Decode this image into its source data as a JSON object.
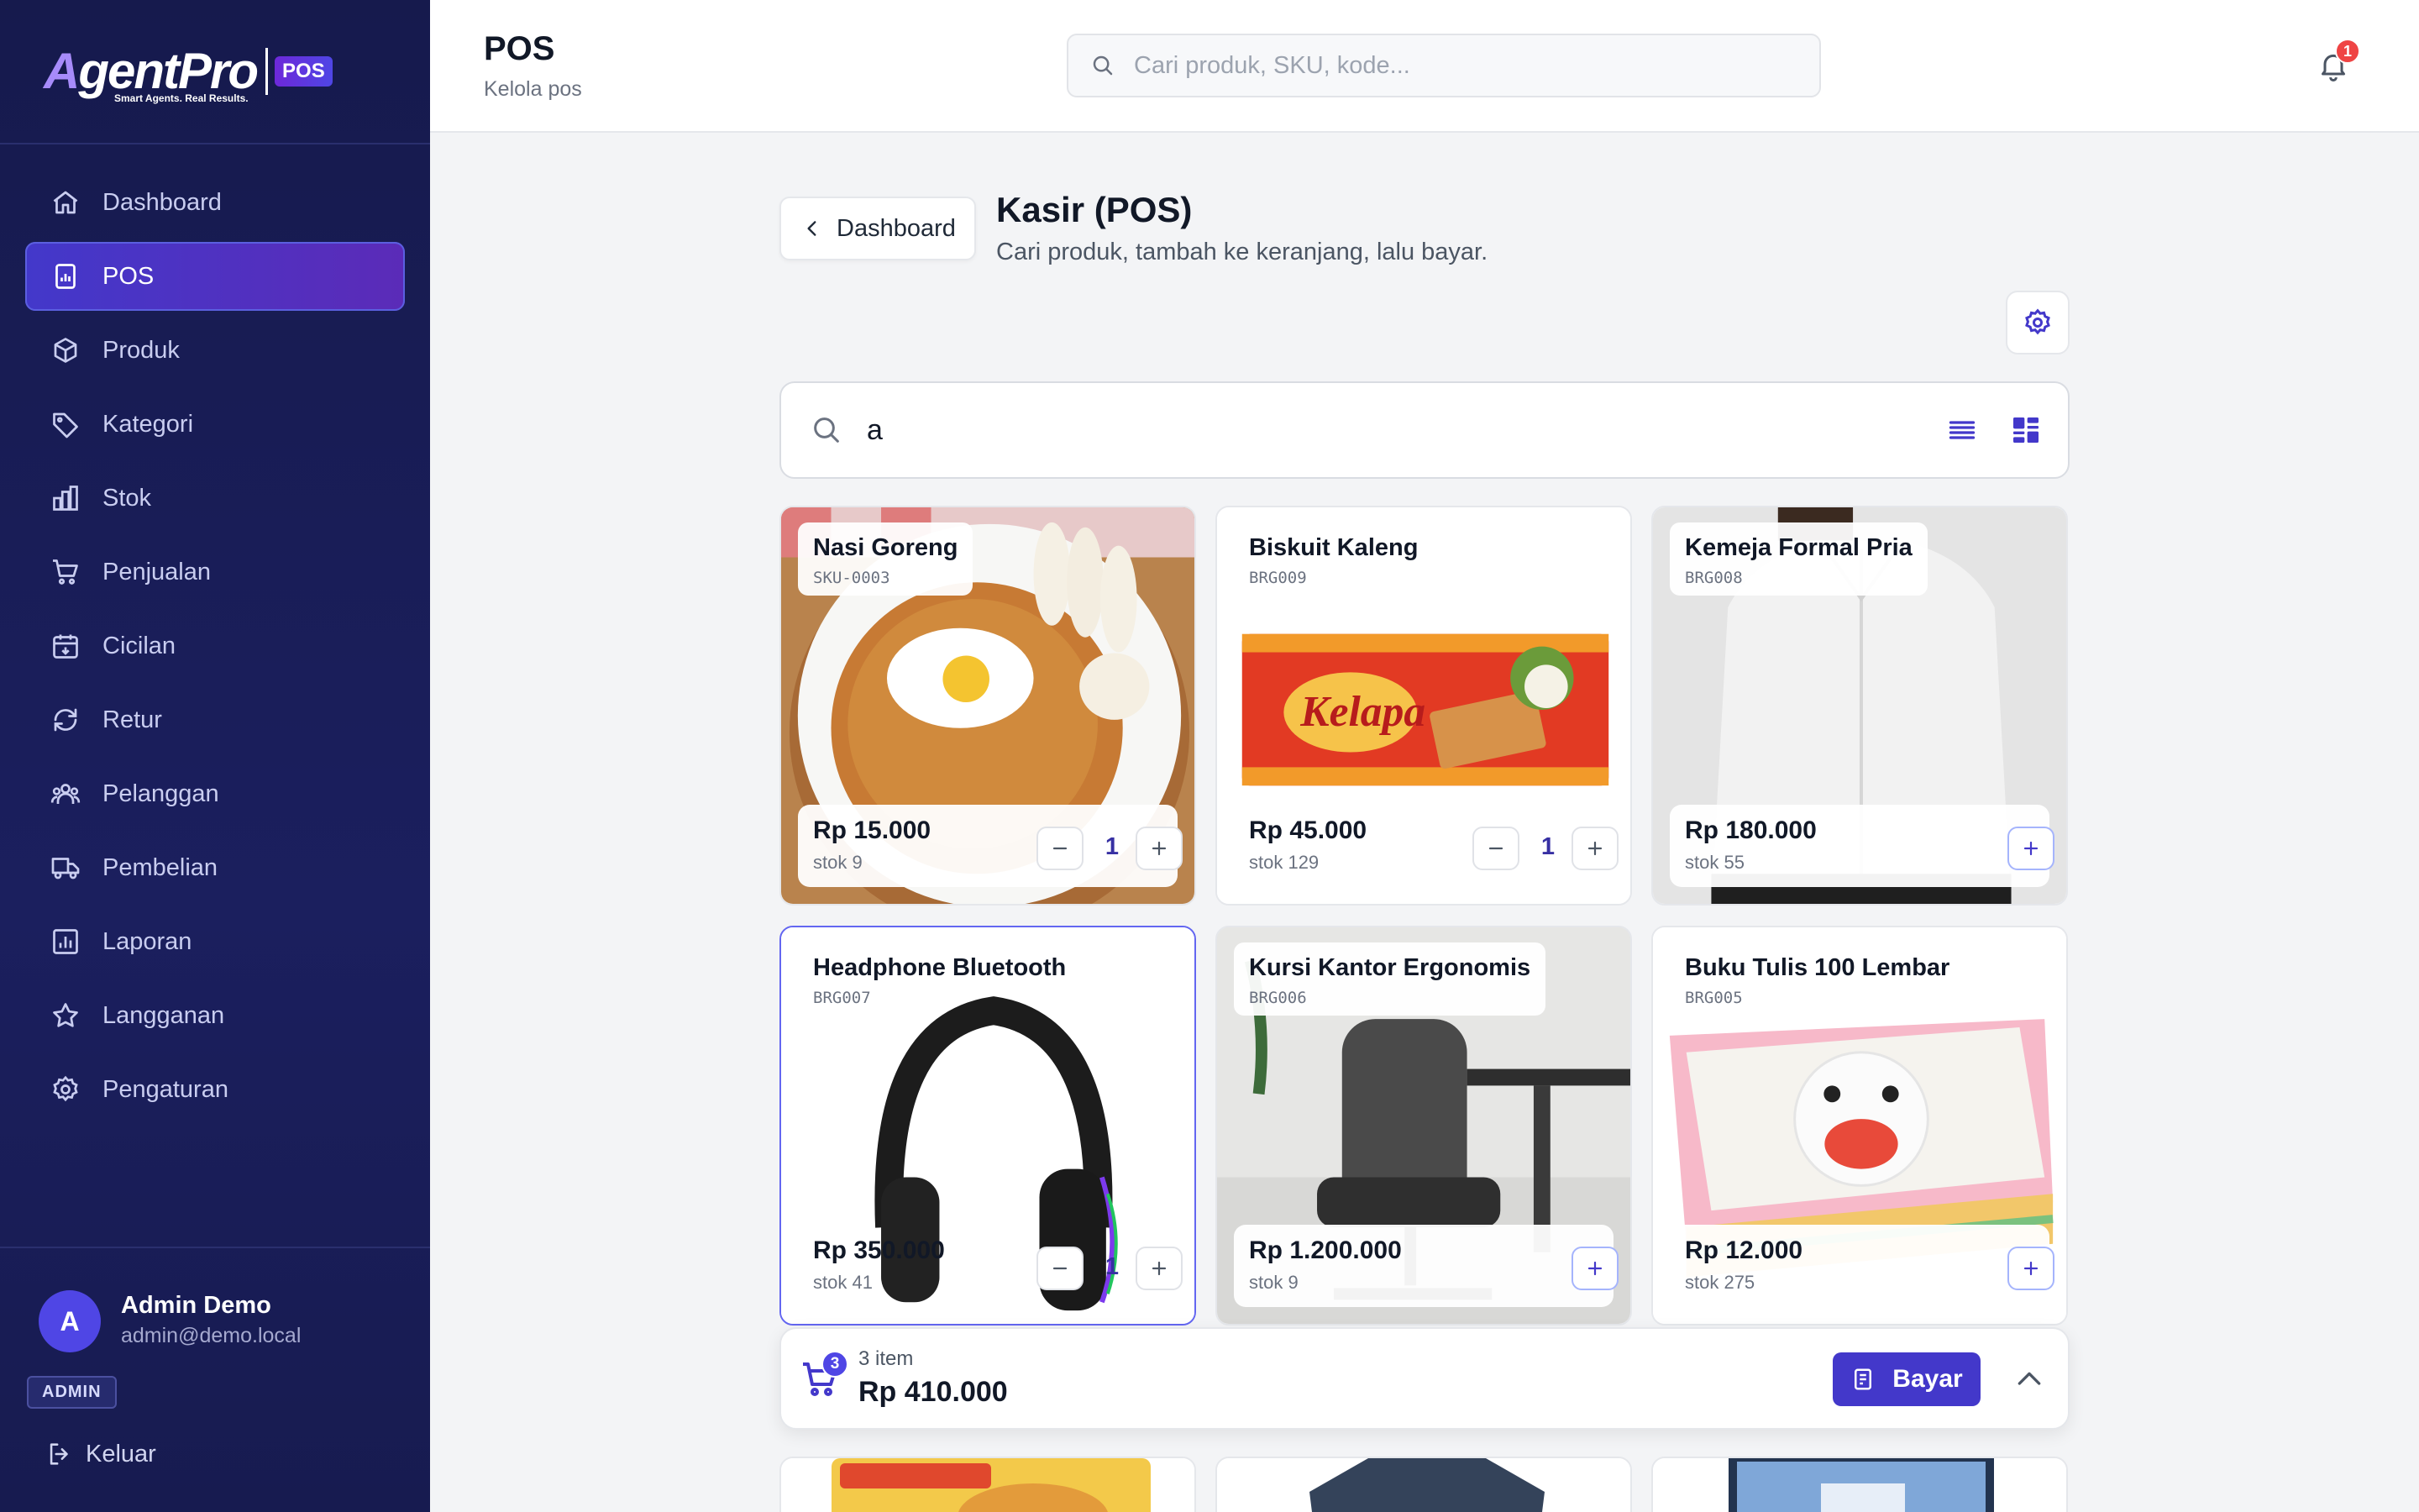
{
  "brand": {
    "name_a": "A",
    "name_rest": "gentPro",
    "tagline": "Smart Agents. Real Results.",
    "badge": "POS"
  },
  "sidebar": {
    "items": [
      {
        "label": "Dashboard",
        "icon": "home-icon"
      },
      {
        "label": "POS",
        "icon": "pos-icon",
        "active": true
      },
      {
        "label": "Produk",
        "icon": "box-icon"
      },
      {
        "label": "Kategori",
        "icon": "tag-icon"
      },
      {
        "label": "Stok",
        "icon": "bar-chart-icon"
      },
      {
        "label": "Penjualan",
        "icon": "cart-icon"
      },
      {
        "label": "Cicilan",
        "icon": "calendar-icon"
      },
      {
        "label": "Retur",
        "icon": "refresh-icon"
      },
      {
        "label": "Pelanggan",
        "icon": "users-icon"
      },
      {
        "label": "Pembelian",
        "icon": "truck-icon"
      },
      {
        "label": "Laporan",
        "icon": "report-icon"
      },
      {
        "label": "Langganan",
        "icon": "star-icon"
      },
      {
        "label": "Pengaturan",
        "icon": "gear-icon"
      }
    ],
    "user": {
      "initial": "A",
      "name": "Admin Demo",
      "email": "admin@demo.local",
      "role": "ADMIN"
    },
    "logout_label": "Keluar"
  },
  "header": {
    "title": "POS",
    "subtitle": "Kelola pos",
    "search_placeholder": "Cari produk, SKU, kode...",
    "notification_count": "1"
  },
  "main": {
    "back_label": "Dashboard",
    "title": "Kasir (POS)",
    "subtitle": "Cari produk, tambah ke keranjang, lalu bayar.",
    "search_value": "a"
  },
  "products": [
    {
      "name": "Nasi Goreng",
      "sku": "SKU-0003",
      "price": "Rp 15.000",
      "stock": "stok 9",
      "qty": "1"
    },
    {
      "name": "Biskuit Kaleng",
      "sku": "BRG009",
      "price": "Rp 45.000",
      "stock": "stok 129",
      "qty": "1"
    },
    {
      "name": "Kemeja Formal Pria",
      "sku": "BRG008",
      "price": "Rp 180.000",
      "stock": "stok 55"
    },
    {
      "name": "Headphone Bluetooth",
      "sku": "BRG007",
      "price": "Rp 350.000",
      "stock": "stok 41",
      "qty": "1"
    },
    {
      "name": "Kursi Kantor Ergonomis",
      "sku": "BRG006",
      "price": "Rp 1.200.000",
      "stock": "stok 9"
    },
    {
      "name": "Buku Tulis 100 Lembar",
      "sku": "BRG005",
      "price": "Rp 12.000",
      "stock": "stok 275"
    }
  ],
  "cart": {
    "count": "3",
    "items_label": "3 item",
    "total": "Rp 410.000",
    "pay_label": "Bayar"
  },
  "colors": {
    "sidebar_bg": "#1b1f5e",
    "accent": "#4338ca",
    "badge_red": "#ef4444"
  }
}
